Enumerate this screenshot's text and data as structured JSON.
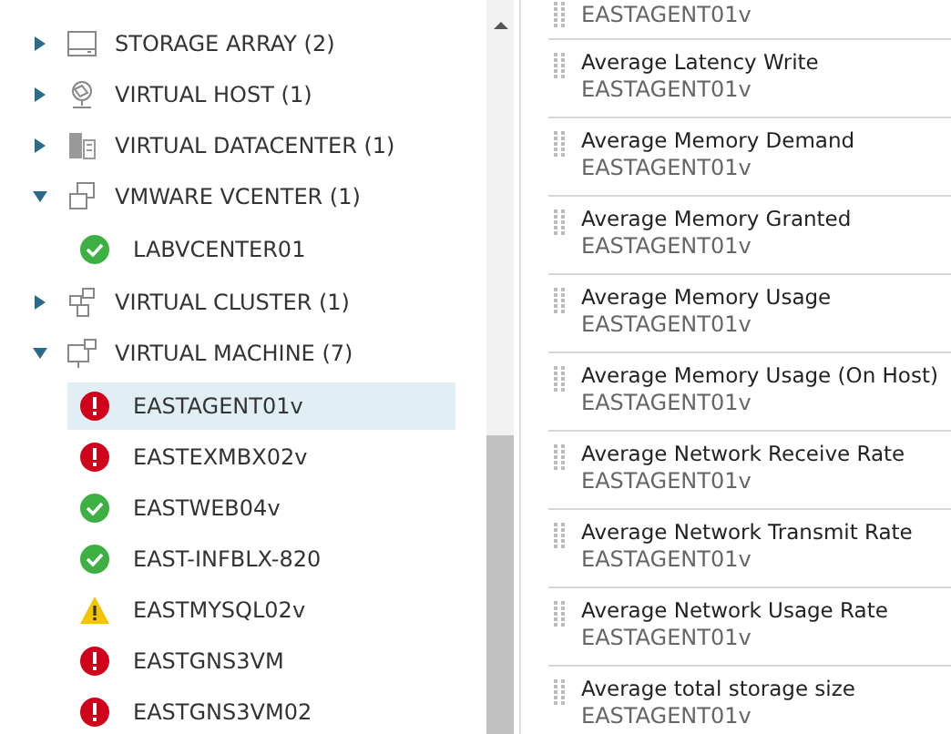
{
  "tree": [
    {
      "label": "STORAGE ARRAY (2)",
      "kind": "storage",
      "expanded": false
    },
    {
      "label": "VIRTUAL HOST (1)",
      "kind": "host",
      "expanded": false
    },
    {
      "label": "VIRTUAL DATACENTER (1)",
      "kind": "datacenter",
      "expanded": false
    },
    {
      "label": "VMWARE VCENTER (1)",
      "kind": "vcenter",
      "expanded": true,
      "children": [
        {
          "label": "LABVCENTER01",
          "kind": "ok",
          "selected": false
        }
      ]
    },
    {
      "label": "VIRTUAL CLUSTER (1)",
      "kind": "cluster",
      "expanded": false
    },
    {
      "label": "VIRTUAL MACHINE (7)",
      "kind": "vm",
      "expanded": true,
      "children": [
        {
          "label": "EASTAGENT01v",
          "kind": "error",
          "selected": true
        },
        {
          "label": "EASTEXMBX02v",
          "kind": "error",
          "selected": false
        },
        {
          "label": "EASTWEB04v",
          "kind": "ok",
          "selected": false
        },
        {
          "label": "EAST-INFBLX-820",
          "kind": "ok",
          "selected": false
        },
        {
          "label": "EASTMYSQL02v",
          "kind": "warning",
          "selected": false
        },
        {
          "label": "EASTGNS3VM",
          "kind": "error",
          "selected": false
        },
        {
          "label": "EASTGNS3VM02",
          "kind": "error",
          "selected": false
        }
      ]
    }
  ],
  "metrics": [
    {
      "subtitle": "EASTAGENT01v"
    },
    {
      "title": "Average Latency Write",
      "subtitle": "EASTAGENT01v"
    },
    {
      "title": "Average Memory Demand",
      "subtitle": "EASTAGENT01v"
    },
    {
      "title": "Average Memory Granted",
      "subtitle": "EASTAGENT01v"
    },
    {
      "title": "Average Memory Usage",
      "subtitle": "EASTAGENT01v"
    },
    {
      "title": "Average Memory Usage (On Host)",
      "subtitle": "EASTAGENT01v"
    },
    {
      "title": "Average Network Receive Rate",
      "subtitle": "EASTAGENT01v"
    },
    {
      "title": "Average Network Transmit Rate",
      "subtitle": "EASTAGENT01v"
    },
    {
      "title": "Average Network Usage Rate",
      "subtitle": "EASTAGENT01v"
    },
    {
      "title": "Average total storage size",
      "subtitle": "EASTAGENT01v"
    }
  ]
}
